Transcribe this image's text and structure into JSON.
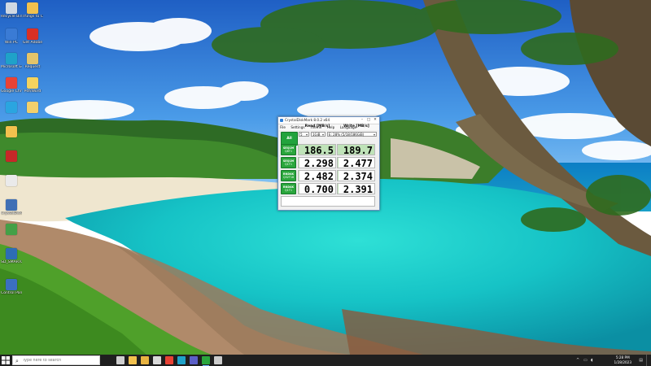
{
  "desktop": {
    "icons": [
      {
        "name": "Recycle Bin",
        "color": "#cfd8e3"
      },
      {
        "name": "Things to CLAIM LO...",
        "color": "#f2c14e"
      },
      {
        "name": "Win PC",
        "color": "#3a7bd5"
      },
      {
        "name": "Get Adobe",
        "color": "#d93025"
      },
      {
        "name": "Microsoft Edge",
        "color": "#1fa2c9"
      },
      {
        "name": "Request",
        "color": "#e3c46a"
      },
      {
        "name": "Google Chrome",
        "color": "#e94235"
      },
      {
        "name": "Pdf/Word",
        "color": "#f4d35e"
      },
      {
        "name": "",
        "color": "#2aa5e0"
      },
      {
        "name": "",
        "color": "#f2d06b"
      },
      {
        "name": "",
        "color": "#f2c14e"
      },
      {
        "name": "",
        "color": "#c62828"
      },
      {
        "name": "",
        "color": "#eaeaea"
      },
      {
        "name": "CrystalDiskM...",
        "color": "#3f6fb5"
      },
      {
        "name": "",
        "color": "#43a047"
      },
      {
        "name": "SD_SMARTC",
        "color": "#2d6db5"
      },
      {
        "name": "Control Pan...",
        "color": "#3b6fc0"
      }
    ]
  },
  "cdm": {
    "title": "CrystalDiskMark 8.0.2 x64",
    "menu": [
      "File",
      "Settings",
      "Theme",
      "Help",
      "Language"
    ],
    "all_label": "All",
    "count": "5",
    "size": "1GiB",
    "drive": "E: 28% (5/18/186GiB)",
    "read_header": "Read [MB/s]",
    "write_header": "Write [MB/s]",
    "accent": "#22a33d",
    "rows": [
      {
        "line1": "SEQ1M",
        "line2": "Q8T1",
        "read": "186.5",
        "write": "189.7",
        "read_frac": 0.99,
        "write_frac": 1.0
      },
      {
        "line1": "SEQ1M",
        "line2": "Q1T1",
        "read": "2.298",
        "write": "2.477",
        "read_frac": 0.02,
        "write_frac": 0.02
      },
      {
        "line1": "RND4K",
        "line2": "Q32T16",
        "read": "2.482",
        "write": "2.374",
        "read_frac": 0.02,
        "write_frac": 0.02
      },
      {
        "line1": "RND4K",
        "line2": "Q1T1",
        "read": "0.700",
        "write": "2.391",
        "read_frac": 0.01,
        "write_frac": 0.02
      }
    ]
  },
  "taskbar": {
    "search_placeholder": "Type here to search",
    "apps": [
      {
        "icon": "task-view-icon",
        "color": "#cfcfcf"
      },
      {
        "icon": "file-explorer-icon",
        "color": "#f2c14e"
      },
      {
        "icon": "folder-icon",
        "color": "#e8b341"
      },
      {
        "icon": "media-icon",
        "color": "#d9d9d9"
      },
      {
        "icon": "chrome-icon",
        "color": "#e94235"
      },
      {
        "icon": "edge-icon",
        "color": "#1fa2c9"
      },
      {
        "icon": "store-icon",
        "color": "#5b5fc7"
      },
      {
        "icon": "crystaldiskmark-icon",
        "color": "#2aa63c"
      },
      {
        "icon": "app-icon",
        "color": "#cccccc"
      }
    ],
    "time": "5:28 PM",
    "date": "1/28/2023"
  }
}
